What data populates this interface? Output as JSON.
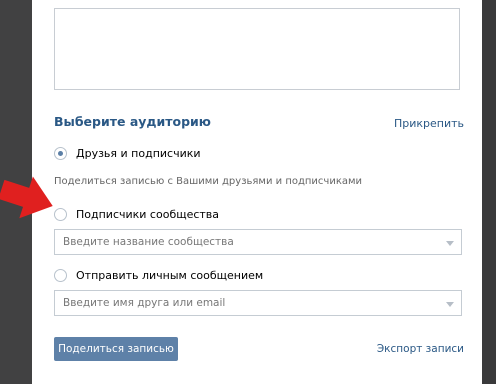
{
  "audience": {
    "title": "Выберите аудиторию",
    "attach_link": "Прикрепить",
    "options": [
      {
        "label": "Друзья и подписчики",
        "hint": "Поделиться записью с Вашими друзьями и подписчиками",
        "checked": true
      },
      {
        "label": "Подписчики сообщества",
        "select_placeholder": "Введите название сообщества",
        "checked": false
      },
      {
        "label": "Отправить личным сообщением",
        "select_placeholder": "Введите имя друга или email",
        "checked": false
      }
    ]
  },
  "footer": {
    "share_button": "Поделиться записью",
    "export_link": "Экспорт записи"
  },
  "colors": {
    "link": "#2a5885",
    "button": "#5e81a8",
    "arrow": "#e0201f"
  }
}
